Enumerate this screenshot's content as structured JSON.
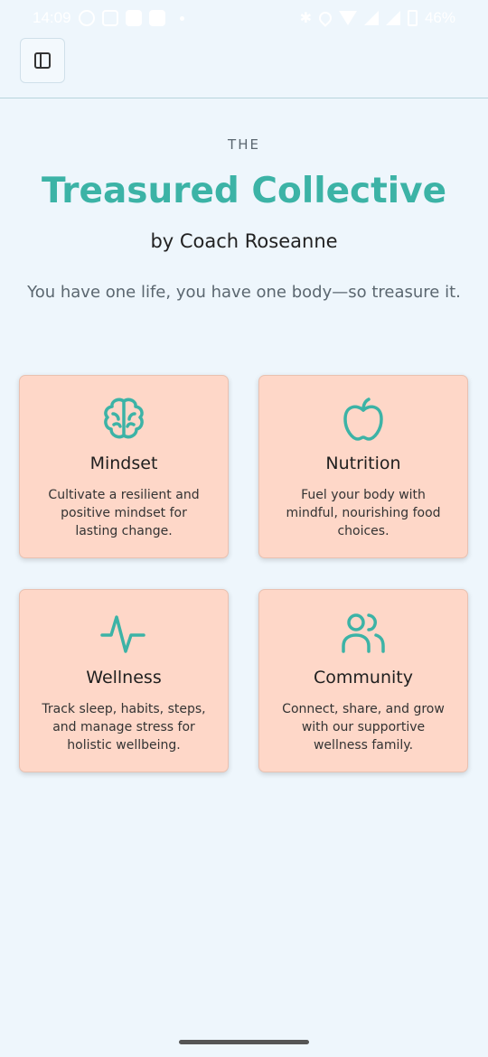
{
  "status_bar": {
    "time": "14:09",
    "battery": "46%"
  },
  "hero": {
    "eyebrow": "THE",
    "title": "Treasured Collective",
    "subtitle": "by Coach Roseanne",
    "tagline": "You have one life, you have one body—so treasure it."
  },
  "colors": {
    "background": "#eef6fc",
    "accent": "#3cb3a6",
    "card": "#fed7c8"
  },
  "cards": [
    {
      "icon": "brain-icon",
      "title": "Mindset",
      "description": "Cultivate a resilient and positive mindset for lasting change."
    },
    {
      "icon": "apple-icon",
      "title": "Nutrition",
      "description": "Fuel your body with mindful, nourishing food choices."
    },
    {
      "icon": "activity-icon",
      "title": "Wellness",
      "description": "Track sleep, habits, steps, and manage stress for holistic wellbeing."
    },
    {
      "icon": "users-icon",
      "title": "Community",
      "description": "Connect, share, and grow with our supportive wellness family."
    }
  ]
}
